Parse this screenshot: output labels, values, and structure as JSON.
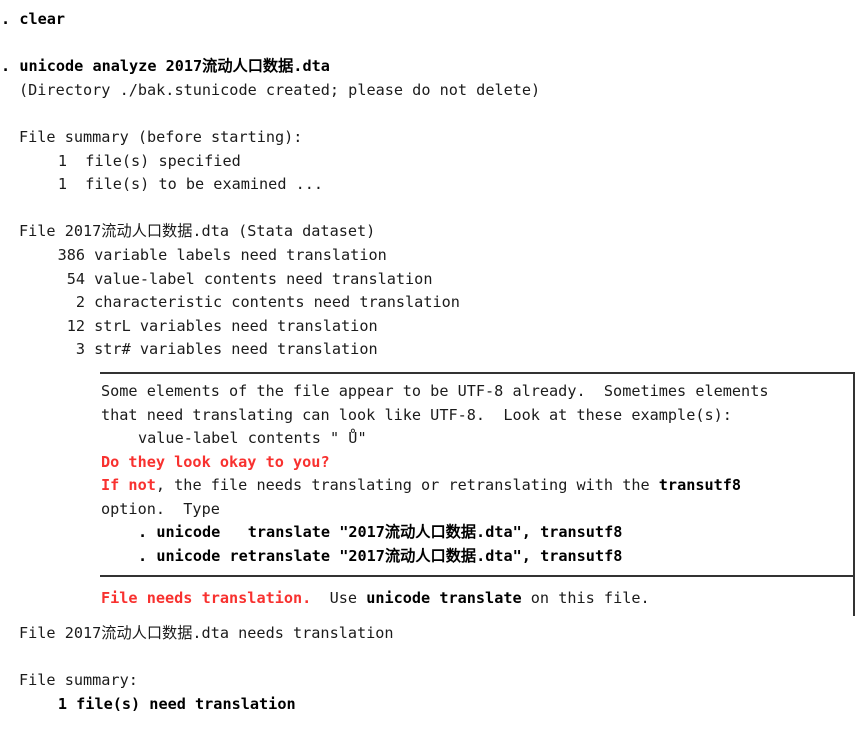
{
  "terminal": {
    "app": "Stata Results",
    "prompt": ".",
    "colors": {
      "text": "#1b1b1b",
      "bold": "#000000",
      "red": "#f8312f",
      "rule": "#333333",
      "background": "#ffffff"
    },
    "filename": "2017流动人口数据.dta"
  },
  "commands": {
    "clear": "clear",
    "analyze": "unicode analyze 2017流动人口数据.dta",
    "translate_example": "unicode   translate \"2017流动人口数据.dta\", transutf8",
    "retranslate_example": "unicode retranslate \"2017流动人口数据.dta\", transutf8"
  },
  "output": {
    "directory_note": "(Directory ./bak.stunicode created; please do not delete)",
    "summary_before_heading": "File summary (before starting):",
    "summary_before_rows": [
      {
        "count": "1",
        "label": "file(s) specified"
      },
      {
        "count": "1",
        "label": "file(s) to be examined ..."
      }
    ],
    "file_heading": "File 2017流动人口数据.dta (Stata dataset)",
    "counts": [
      {
        "count": "386",
        "label": "variable labels need translation"
      },
      {
        "count": "54",
        "label": "value-label contents need translation"
      },
      {
        "count": "2",
        "label": "characteristic contents need translation"
      },
      {
        "count": "12",
        "label": "strL variables need translation"
      },
      {
        "count": "3",
        "label": "str# variables need translation"
      }
    ],
    "notice": {
      "paragraph_line1": "Some elements of the file appear to be UTF-8 already.  Sometimes elements",
      "paragraph_line2": "that need translating can look like UTF-8.  Look at these example(s):",
      "example": "value-label contents \" Ů\"",
      "question": "Do they look okay to you?",
      "if_not_prefix": "If not",
      "if_not_rest": ", the file needs translating or retranslating with the ",
      "transutf8_bold": "transutf8",
      "option_type": "option.  Type",
      "cmd_prompt": ".",
      "cmd1_word": "unicode",
      "cmd1_verb": "translate",
      "cmd1_arg": "\"2017流动人口数据.dta\", transutf8",
      "cmd2_word": "unicode",
      "cmd2_verb": "retranslate",
      "cmd2_arg": "\"2017流动人口数据.dta\", transutf8",
      "verdict_red": "File needs translation.",
      "verdict_use": "Use ",
      "verdict_cmd": "unicode translate",
      "verdict_tail": " on this file."
    },
    "file_needs": "File 2017流动人口数据.dta needs translation",
    "summary_after_heading": "File summary:",
    "summary_after_row": {
      "count": "1",
      "label": "file(s) need translation"
    }
  }
}
